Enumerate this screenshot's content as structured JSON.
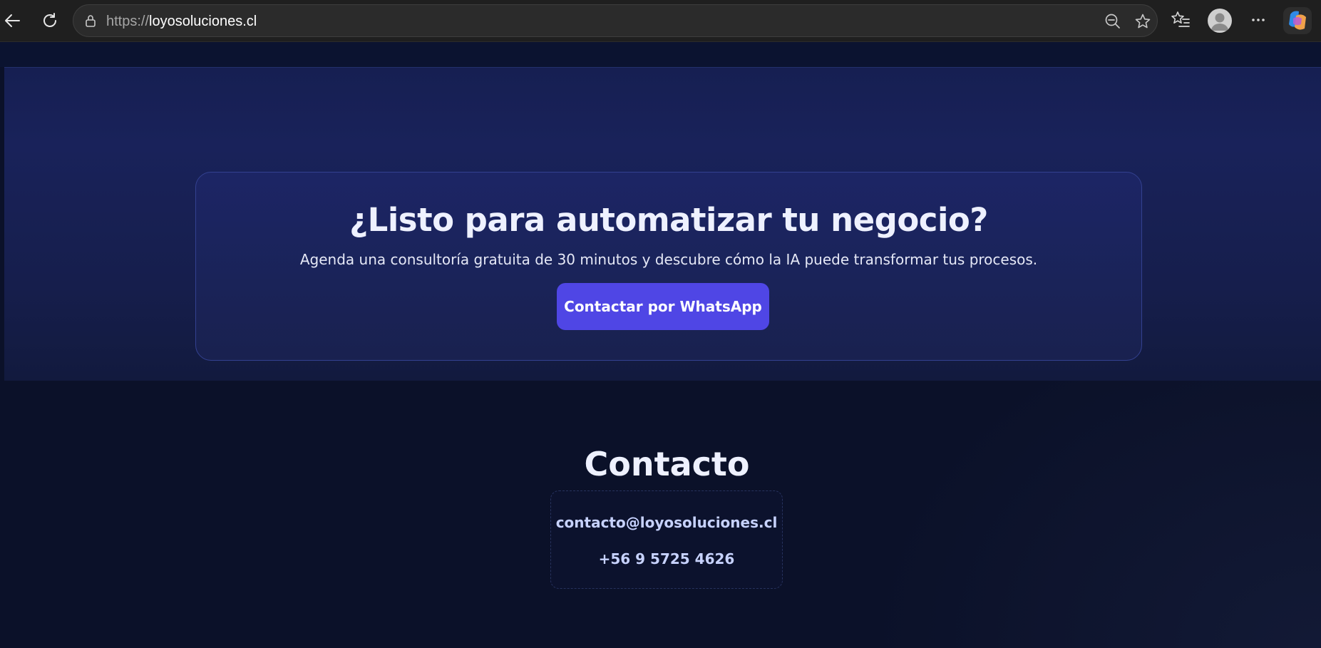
{
  "browser": {
    "url_scheme": "https://",
    "url_host": "loyosoluciones.cl",
    "icons": {
      "back": "back-arrow-icon",
      "reload": "reload-icon",
      "lock": "lock-icon",
      "zoom": "zoom-out-icon",
      "favorite": "star-icon",
      "favorites": "favorites-list-icon",
      "profile": "profile-avatar",
      "more": "more-dots-icon",
      "copilot": "copilot-icon"
    }
  },
  "cta": {
    "title": "¿Listo para automatizar tu negocio?",
    "subtitle": "Agenda una consultoría gratuita de 30 minutos y descubre cómo la IA puede transformar tus procesos.",
    "button_label": "Contactar por WhatsApp"
  },
  "contact": {
    "title": "Contacto",
    "email": "contacto@loyosoluciones.cl",
    "phone": "+56 9 5725 4626"
  },
  "colors": {
    "page_bg": "#0b1129",
    "cta_bg": "#19225a",
    "button_bg": "#4f46e5",
    "contact_text": "#c7d2fe"
  }
}
